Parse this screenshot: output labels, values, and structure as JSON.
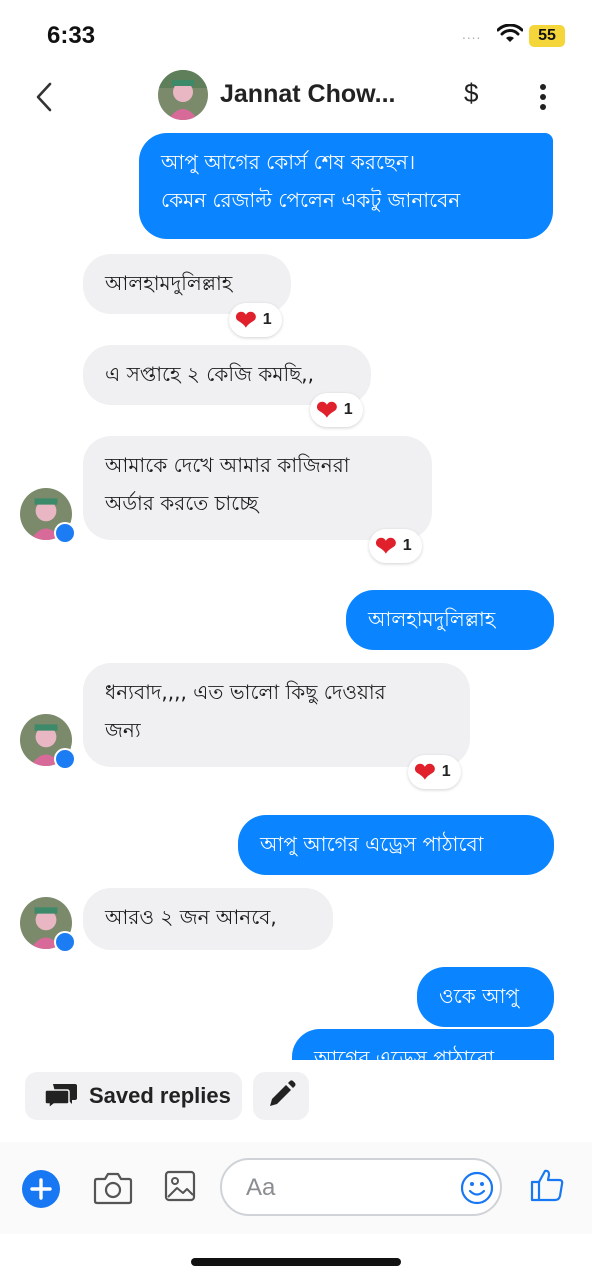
{
  "status_bar": {
    "time": "6:33",
    "signal": "....",
    "battery": "55"
  },
  "header": {
    "contact_name": "Jannat Chow...",
    "currency_symbol": "$"
  },
  "messages": [
    {
      "direction": "outgoing",
      "lines": [
        "আপু আগের কোর্স শেষ করছেন।",
        "কেমন রেজাল্ট পেলেন একটু জানাবেন"
      ]
    },
    {
      "direction": "incoming",
      "lines": [
        "আলহামদুলিল্লাহ"
      ],
      "reaction": {
        "emoji": "❤",
        "count": "1"
      }
    },
    {
      "direction": "incoming",
      "lines": [
        "এ সপ্তাহে ২ কেজি কমছি,,"
      ],
      "reaction": {
        "emoji": "❤",
        "count": "1"
      }
    },
    {
      "direction": "incoming",
      "lines": [
        "আমাকে দেখে আমার কাজিনরা",
        "অর্ডার করতে চাচ্ছে"
      ],
      "reaction": {
        "emoji": "❤",
        "count": "1"
      }
    },
    {
      "direction": "outgoing",
      "lines": [
        "আলহামদুলিল্লাহ"
      ]
    },
    {
      "direction": "incoming",
      "lines": [
        "ধন্যবাদ,,,, এত ভালো কিছু দেওয়ার",
        "জন্য"
      ],
      "reaction": {
        "emoji": "❤",
        "count": "1"
      }
    },
    {
      "direction": "outgoing",
      "lines": [
        "আপু আগের এড্রেস পাঠাবো"
      ]
    },
    {
      "direction": "incoming",
      "lines": [
        "আরও ২ জন আনবে,"
      ]
    },
    {
      "direction": "outgoing",
      "lines": [
        "ওকে আপু"
      ]
    },
    {
      "direction": "outgoing",
      "lines": [
        "আগের এড্রেস পাঠাবো"
      ]
    }
  ],
  "quick_actions": {
    "saved_replies_label": "Saved replies"
  },
  "composer": {
    "placeholder": "Aa"
  },
  "colors": {
    "outgoing_bubble": "#0a84ff",
    "incoming_bubble": "#f0f0f2",
    "heart": "#e0202a",
    "messenger_blue": "#1877f2"
  }
}
